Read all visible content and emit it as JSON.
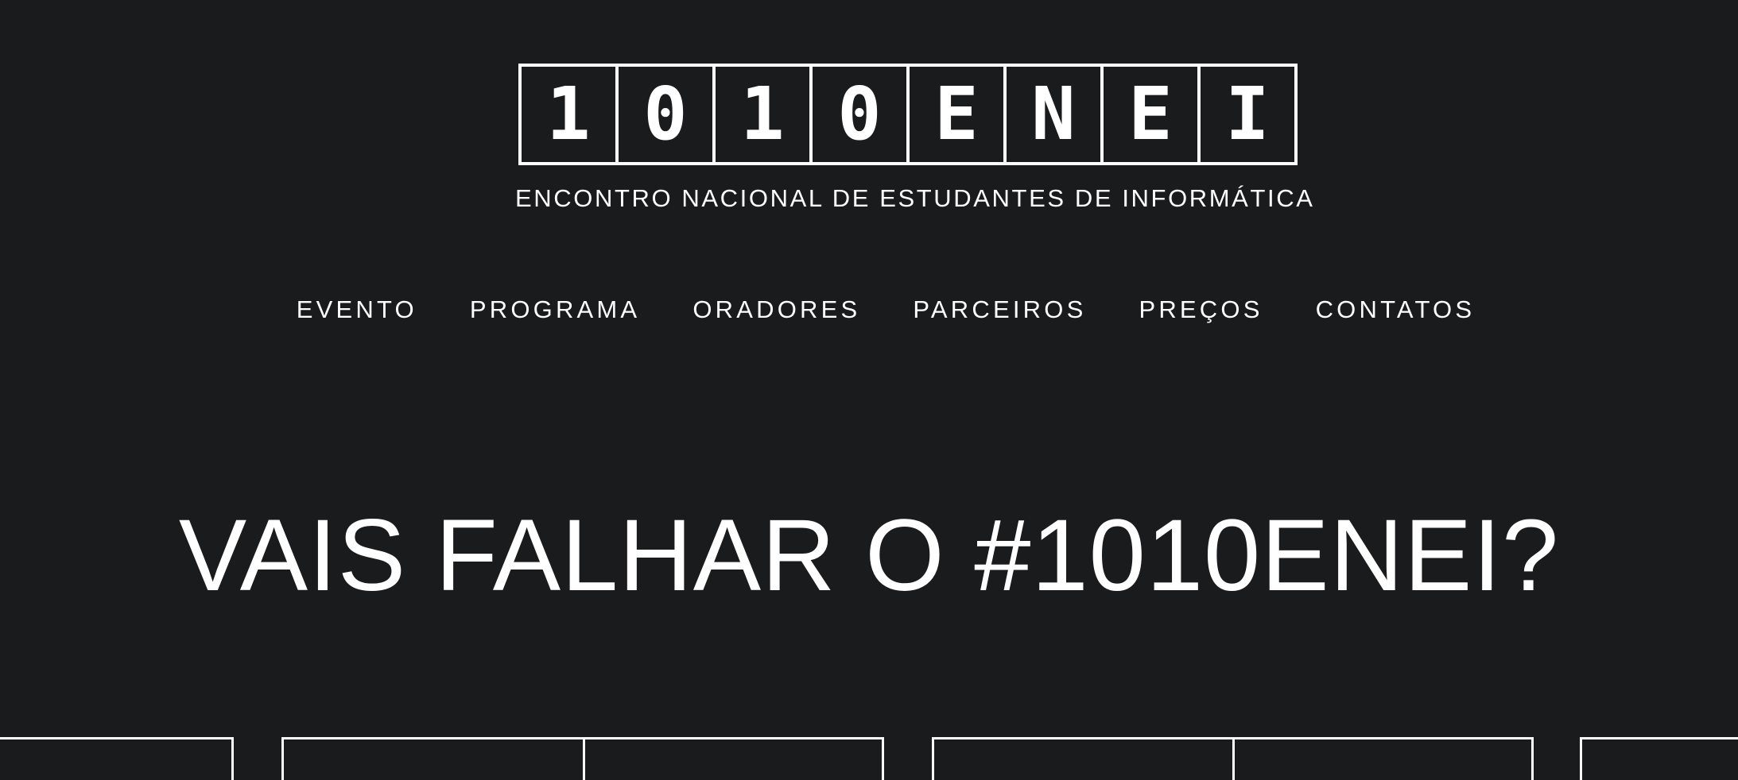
{
  "logo": {
    "characters": [
      "1",
      "0",
      "1",
      "0",
      "E",
      "N",
      "E",
      "I"
    ]
  },
  "tagline": "ENCONTRO NACIONAL DE ESTUDANTES DE INFORMÁTICA",
  "nav": {
    "items": [
      {
        "label": "EVENTO"
      },
      {
        "label": "PROGRAMA"
      },
      {
        "label": "ORADORES"
      },
      {
        "label": "PARCEIROS"
      },
      {
        "label": "PREÇOS"
      },
      {
        "label": "CONTATOS"
      }
    ]
  },
  "hero": {
    "title": "VAIS FALHAR O #1010ENEI?"
  },
  "colors": {
    "background": "#1a1b1d",
    "foreground": "#ffffff"
  }
}
